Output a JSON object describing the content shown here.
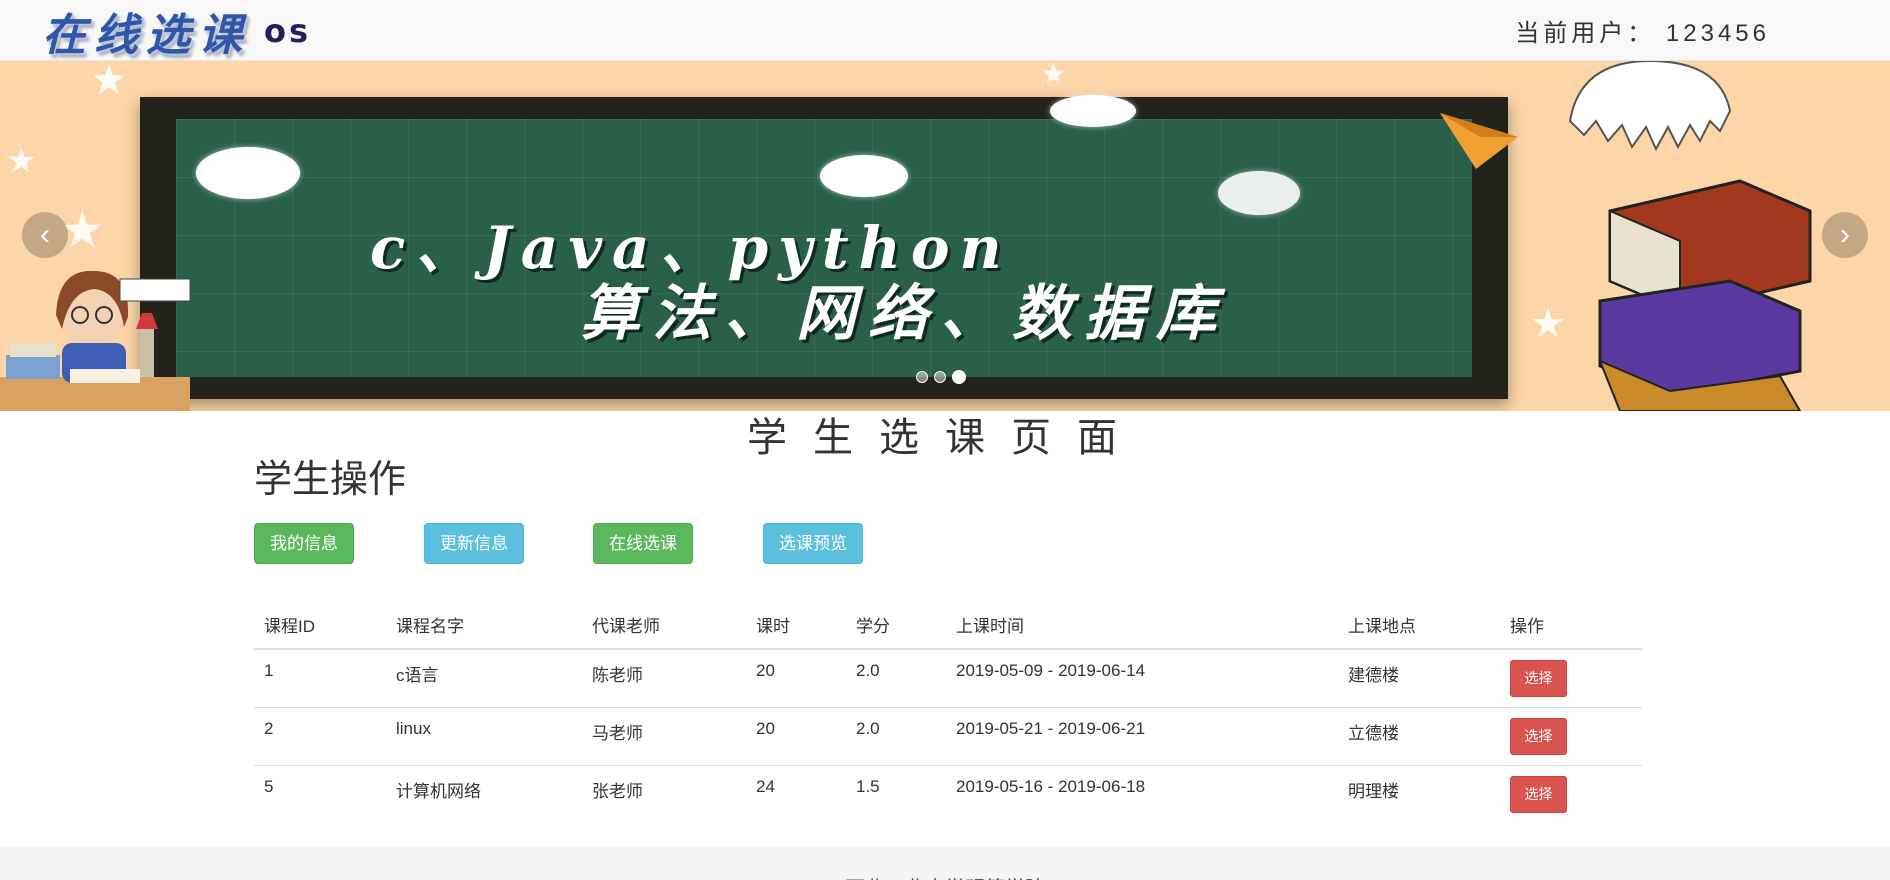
{
  "navbar": {
    "brand_cn": "在线选课",
    "brand_os": "os",
    "current_user": "当前用户： 123456"
  },
  "banner": {
    "line1": "c、Java、python",
    "line2": "算法、网络、数据库",
    "slide_count": 3,
    "active_slide": 3
  },
  "page": {
    "title": "学生选课页面",
    "section_title": "学生操作"
  },
  "actions": {
    "my_info": "我的信息",
    "update_info": "更新信息",
    "online_select": "在线选课",
    "select_preview": "选课预览"
  },
  "table": {
    "headers": [
      "课程ID",
      "课程名字",
      "代课老师",
      "课时",
      "学分",
      "上课时间",
      "上课地点",
      "操作"
    ],
    "rows": [
      {
        "id": "1",
        "name": "c语言",
        "teacher": "陈老师",
        "hours": "20",
        "credit": "2.0",
        "time": "2019-05-09 - 2019-06-14",
        "place": "建德楼",
        "action": "选择"
      },
      {
        "id": "2",
        "name": "linux",
        "teacher": "马老师",
        "hours": "20",
        "credit": "2.0",
        "time": "2019-05-21 - 2019-06-21",
        "place": "立德楼",
        "action": "选择"
      },
      {
        "id": "5",
        "name": "计算机网络",
        "teacher": "张老师",
        "hours": "24",
        "credit": "1.5",
        "time": "2019-05-16 - 2019-06-18",
        "place": "明理楼",
        "action": "选择"
      }
    ]
  },
  "footer": {
    "text": "西北工业大学明德学院"
  },
  "colors": {
    "success": "#5cb85c",
    "info": "#5bc0de",
    "danger": "#d9534f",
    "banner_bg": "#fcd6a8",
    "chalkboard": "#2a5f4a"
  }
}
